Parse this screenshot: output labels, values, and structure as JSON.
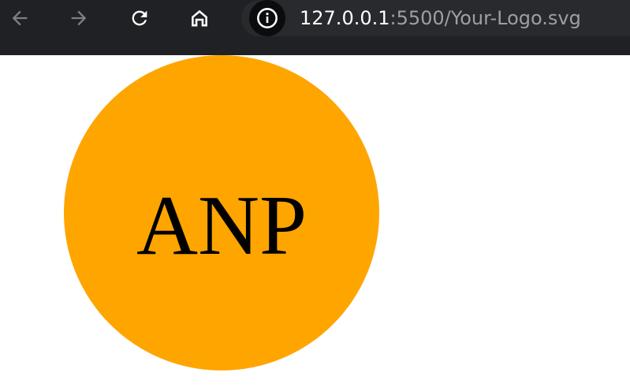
{
  "browser": {
    "nav": {
      "back_icon": "arrow-left-icon",
      "forward_icon": "arrow-right-icon",
      "reload_icon": "reload-icon",
      "home_icon": "home-icon"
    },
    "address_bar": {
      "site_info_icon": "info-circle-icon",
      "url_host": "127.0.0.1",
      "url_rest": ":5500/Your-Logo.svg"
    }
  },
  "content": {
    "logo": {
      "text": "ANP",
      "fill_color": "#FFA500",
      "text_color": "#000000"
    }
  }
}
